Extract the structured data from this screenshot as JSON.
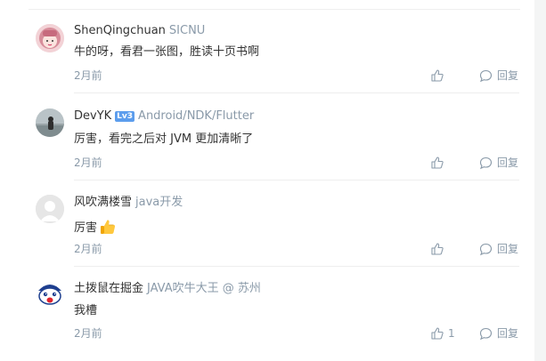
{
  "comments": [
    {
      "username": "ShenQingchuan",
      "meta": "SICNU",
      "content": "牛的呀，看君一张图，胜读十页书啊",
      "time": "2月前",
      "like_count": "",
      "reply_label": "回复"
    },
    {
      "username": "DevYK",
      "level": "Lv3",
      "meta": "Android/NDK/Flutter",
      "content": "厉害，看完之后对 JVM 更加清晰了",
      "time": "2月前",
      "like_count": "",
      "reply_label": "回复"
    },
    {
      "username": "风吹满楼雪",
      "meta": "java开发",
      "content": "厉害",
      "emoji": "thumbs-up-emoji",
      "time": "2月前",
      "like_count": "",
      "reply_label": "回复"
    },
    {
      "username": "土拨鼠在掘金",
      "meta": "JAVA吹牛大王 @ 苏州",
      "content": "我槽",
      "time": "2月前",
      "like_count": "1",
      "reply_label": "回复"
    }
  ],
  "icons": {
    "like": "thumb-up-icon",
    "reply": "comment-bubble-icon"
  },
  "colors": {
    "meta": "#8a9aa9",
    "level_badge": "#5c9ded",
    "divider": "#eeeeee"
  }
}
